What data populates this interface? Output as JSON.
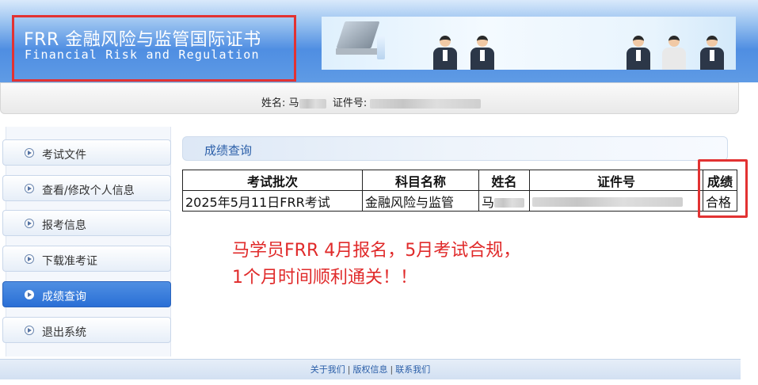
{
  "header": {
    "logo_title": "FRR 金融风险与监管国际证书",
    "logo_subtitle": "Financial Risk and Regulation"
  },
  "info_bar": {
    "name_label": "姓名:",
    "name_value": "马",
    "id_label": "证件号:"
  },
  "sidebar": {
    "items": [
      {
        "label": "考试文件",
        "icon": "arrow-circle-icon",
        "active": false
      },
      {
        "label": "查看/修改个人信息",
        "icon": "arrow-circle-icon",
        "active": false
      },
      {
        "label": "报考信息",
        "icon": "arrow-circle-icon",
        "active": false
      },
      {
        "label": "下载准考证",
        "icon": "arrow-circle-icon",
        "active": false
      },
      {
        "label": "成绩查询",
        "icon": "arrow-circle-icon",
        "active": true
      },
      {
        "label": "退出系统",
        "icon": "arrow-circle-icon",
        "active": false
      }
    ]
  },
  "main": {
    "section_title": "成绩查询",
    "table": {
      "headers": [
        "考试批次",
        "科目名称",
        "姓名",
        "证件号",
        "成绩"
      ],
      "rows": [
        [
          "2025年5月11日FRR考试",
          "金融风险与监管",
          "马",
          "",
          "合格"
        ]
      ]
    },
    "annotation_line1": "马学员FRR 4月报名，5月考试合规，",
    "annotation_line2": "1个月时间顺利通关！！"
  },
  "footer": {
    "links": [
      "关于我们",
      "版权信息",
      "联系我们"
    ],
    "separator": "|"
  },
  "colors": {
    "accent": "#4f8ee2",
    "highlight_border": "#e23232",
    "annotation": "#e02a2a"
  }
}
